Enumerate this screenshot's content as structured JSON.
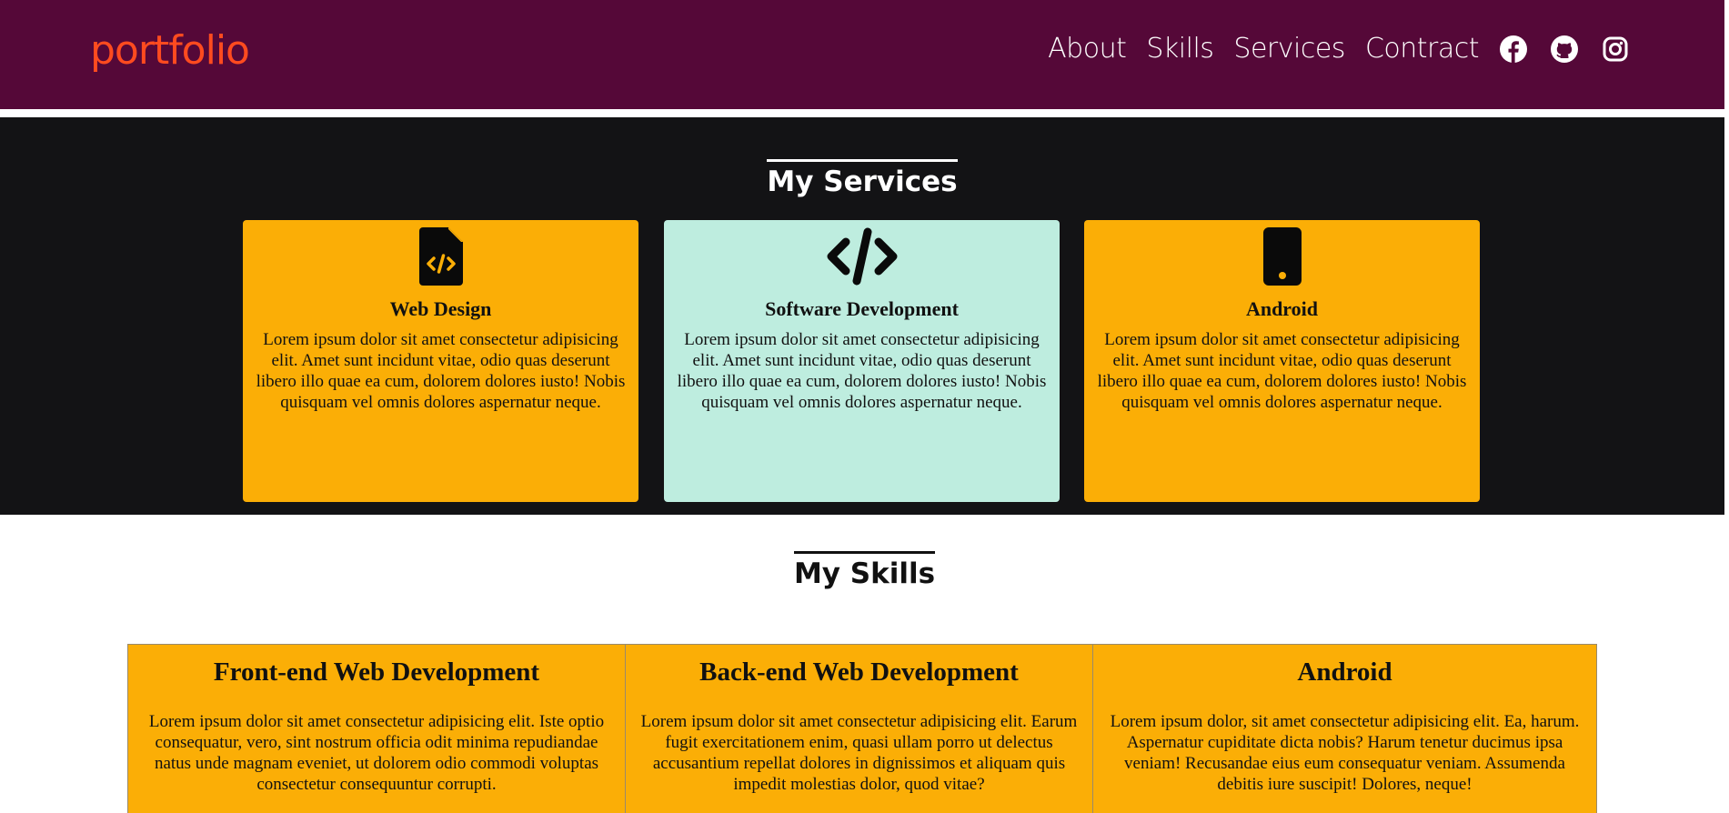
{
  "colors": {
    "header_bg": "#550838",
    "logo": "#ff4b1f",
    "services_bg": "#131315",
    "card_orange": "#fbae06",
    "card_mint": "#beeddf"
  },
  "header": {
    "logo": "portfolio",
    "nav": [
      "About",
      "Skills",
      "Services",
      "Contract"
    ],
    "social_icons": [
      "facebook-icon",
      "github-icon",
      "instagram-icon"
    ]
  },
  "services": {
    "title": "My Services",
    "cards": [
      {
        "icon": "file-code-icon",
        "title": "Web Design",
        "text": "Lorem ipsum dolor sit amet consectetur adipisicing elit. Amet sunt incidunt vitae, odio quas deserunt libero illo quae ea cum, dolorem dolores iusto! Nobis quisquam vel omnis dolores aspernatur neque."
      },
      {
        "icon": "code-icon",
        "title": "Software Development",
        "text": "Lorem ipsum dolor sit amet consectetur adipisicing elit. Amet sunt incidunt vitae, odio quas deserunt libero illo quae ea cum, dolorem dolores iusto! Nobis quisquam vel omnis dolores aspernatur neque."
      },
      {
        "icon": "mobile-phone-icon",
        "title": "Android",
        "text": "Lorem ipsum dolor sit amet consectetur adipisicing elit. Amet sunt incidunt vitae, odio quas deserunt libero illo quae ea cum, dolorem dolores iusto! Nobis quisquam vel omnis dolores aspernatur neque."
      }
    ]
  },
  "skills": {
    "title": "My Skills",
    "columns": [
      {
        "title": "Front-end Web Development",
        "text": "Lorem ipsum dolor sit amet consectetur adipisicing elit. Iste optio consequatur, vero, sint nostrum officia odit minima repudiandae natus unde magnam eveniet, ut dolorem odio commodi voluptas consectetur consequuntur corrupti."
      },
      {
        "title": "Back-end Web Development",
        "text": "Lorem ipsum dolor sit amet consectetur adipisicing elit. Earum fugit exercitationem enim, quasi ullam porro ut delectus accusantium repellat dolores in dignissimos et aliquam quis impedit molestias dolor, quod vitae?"
      },
      {
        "title": "Android",
        "text": "Lorem ipsum dolor, sit amet consectetur adipisicing elit. Ea, harum. Aspernatur cupiditate dicta nobis? Harum tenetur ducimus ipsa veniam! Recusandae eius eum consequatur veniam. Assumenda debitis iure suscipit! Dolores, neque!"
      }
    ]
  }
}
